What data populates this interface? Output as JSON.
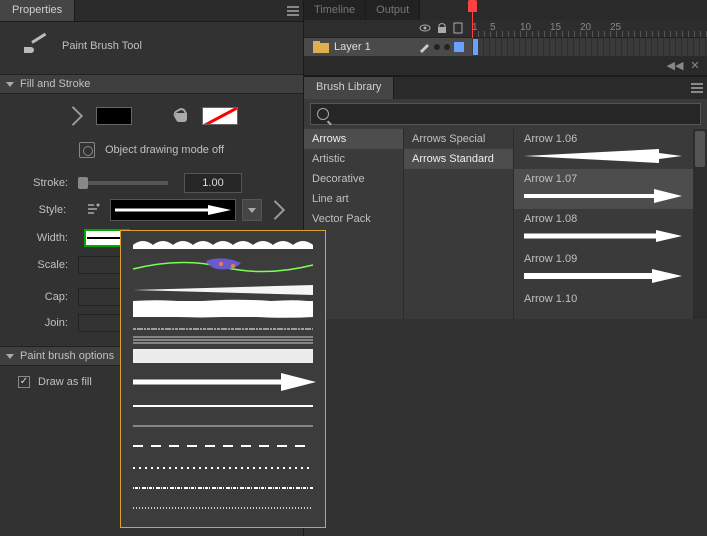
{
  "properties": {
    "tab_label": "Properties",
    "tool_name": "Paint Brush Tool"
  },
  "fill_stroke": {
    "header": "Fill and Stroke",
    "object_drawing": "Object drawing mode off",
    "stroke_label": "Stroke:",
    "stroke_value": "1.00",
    "style_label": "Style:",
    "width_label": "Width:",
    "scale_label": "Scale:",
    "cap_label": "Cap:",
    "join_label": "Join:"
  },
  "paint_brush_options": {
    "header": "Paint brush options",
    "draw_as_fill_label": "Draw as fill",
    "draw_as_fill_checked": true
  },
  "timeline": {
    "tabs": [
      "Timeline",
      "Output"
    ],
    "layer_name": "Layer 1",
    "ruler": [
      "1",
      "5",
      "10",
      "15",
      "20",
      "25"
    ]
  },
  "brush_library": {
    "tab_label": "Brush Library",
    "search_placeholder": "",
    "categories": [
      "Arrows",
      "Artistic",
      "Decorative",
      "Line art",
      "Vector Pack"
    ],
    "category_selected": 0,
    "subcategories": [
      "Arrows Special",
      "Arrows Standard"
    ],
    "subcategory_selected": 1,
    "brushes": [
      "Arrow 1.06",
      "Arrow 1.07",
      "Arrow 1.08",
      "Arrow 1.09",
      "Arrow 1.10"
    ],
    "brush_selected": 1
  }
}
